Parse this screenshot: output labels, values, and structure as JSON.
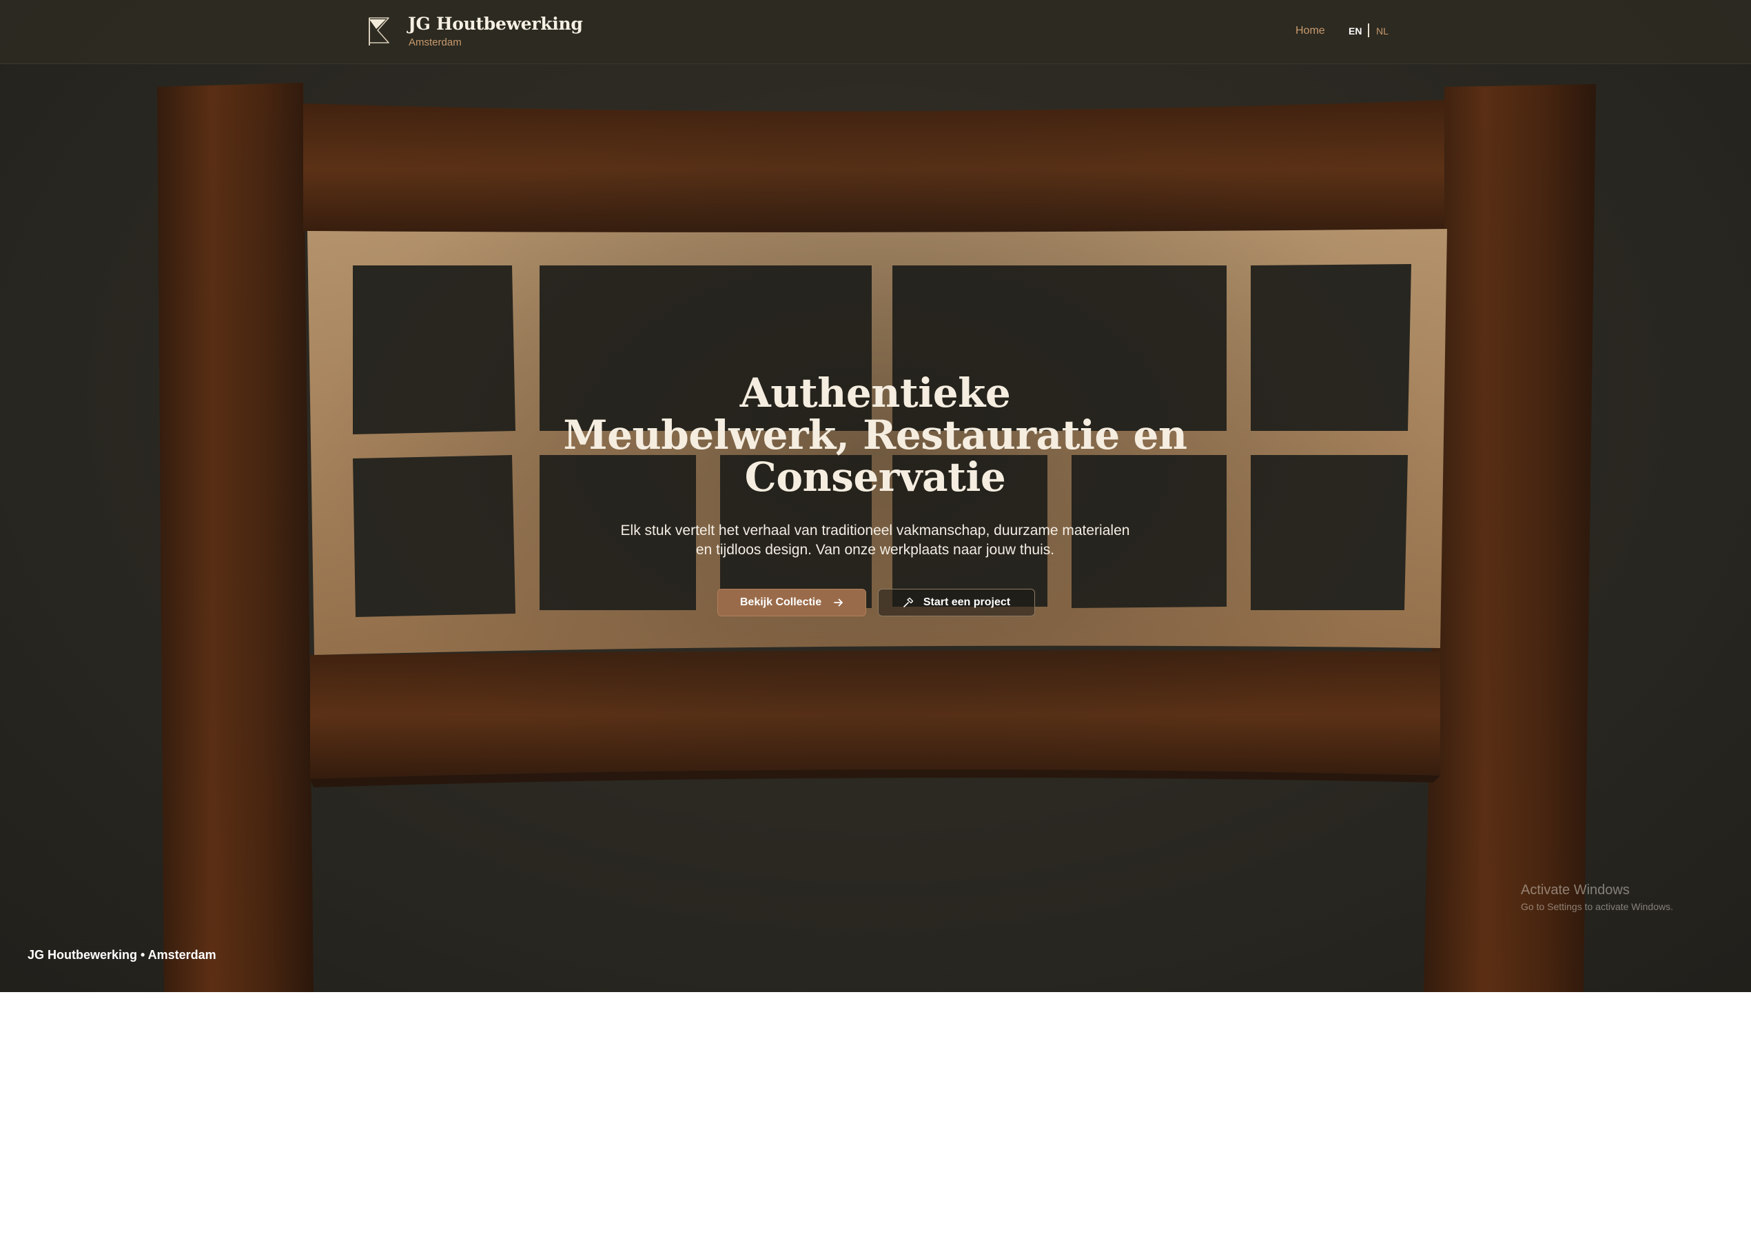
{
  "header": {
    "brand_name": "JG Houtbewerking",
    "brand_city": "Amsterdam",
    "nav_home": "Home",
    "lang_en": "EN",
    "lang_nl": "NL",
    "logo_icon": "flag-logo-icon"
  },
  "hero": {
    "title_line1": "Authentieke",
    "title_line2": "Meubelwerk, Restauratie en",
    "title_line3": "Conservatie",
    "subtitle_line1": "Elk stuk vertelt het verhaal van traditioneel vakmanschap, duurzame materialen",
    "subtitle_line2": "en tijdloos design. Van onze werkplaats naar jouw thuis.",
    "primary_button": "Bekijk Collectie",
    "primary_button_icon": "arrow-right-icon",
    "secondary_button": "Start een project",
    "secondary_button_icon": "hammer-icon",
    "footer_tag": "JG Houtbewerking • Amsterdam"
  },
  "system": {
    "activation_title": "Activate Windows",
    "activation_sub": "Go to Settings to activate Windows."
  },
  "colors": {
    "accent": "#c89a6e",
    "button_primary": "#9a6b4a",
    "header_bg": "#2c2a22",
    "text_light": "#f5ede0"
  }
}
